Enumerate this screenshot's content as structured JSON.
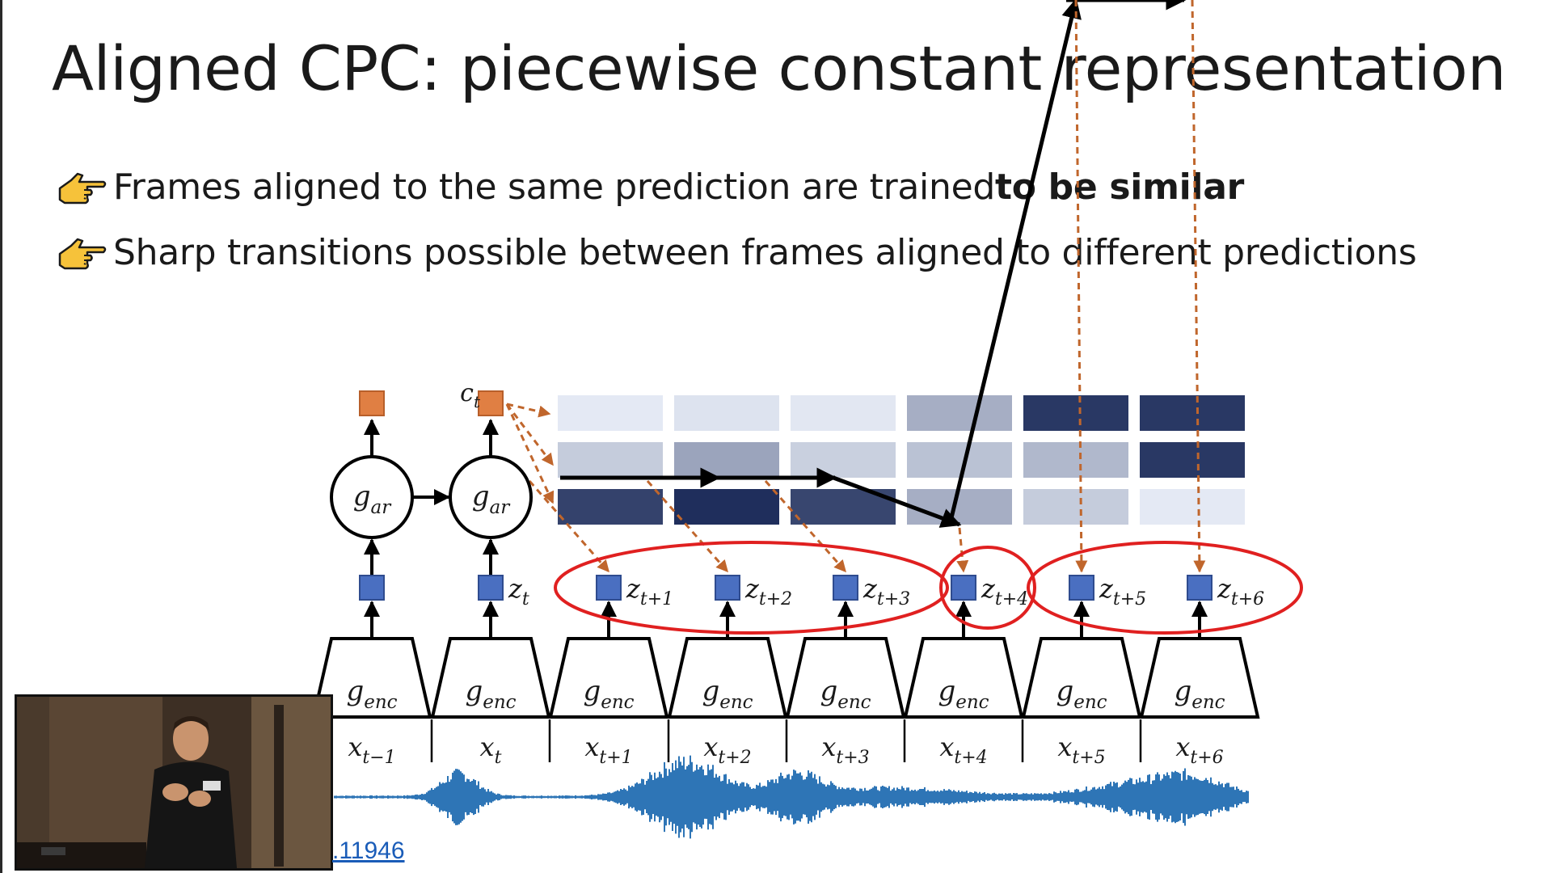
{
  "slide": {
    "title": "Aligned CPC: piecewise constant representation",
    "bullets": [
      {
        "text": "Frames aligned to the same prediction are trained ",
        "bold": "to be similar",
        "icon": "pointing-hand-icon"
      },
      {
        "text": "Sharp transitions possible between frames aligned to different predictions",
        "bold": "",
        "icon": "pointing-hand-icon"
      }
    ],
    "link_text": ".11946"
  },
  "diagram": {
    "context_label": "c",
    "context_sub": "t",
    "ar_nodes": [
      {
        "main": "g",
        "sub": "ar"
      },
      {
        "main": "g",
        "sub": "ar"
      }
    ],
    "z_labels": [
      {
        "main": "",
        "sub": ""
      },
      {
        "main": "z",
        "sub": "t"
      },
      {
        "main": "z",
        "sub": "t+1"
      },
      {
        "main": "z",
        "sub": "t+2"
      },
      {
        "main": "z",
        "sub": "t+3"
      },
      {
        "main": "z",
        "sub": "t+4"
      },
      {
        "main": "z",
        "sub": "t+5"
      },
      {
        "main": "z",
        "sub": "t+6"
      }
    ],
    "encoders": [
      {
        "main": "g",
        "sub": "enc"
      },
      {
        "main": "g",
        "sub": "enc"
      },
      {
        "main": "g",
        "sub": "enc"
      },
      {
        "main": "g",
        "sub": "enc"
      },
      {
        "main": "g",
        "sub": "enc"
      },
      {
        "main": "g",
        "sub": "enc"
      },
      {
        "main": "g",
        "sub": "enc"
      },
      {
        "main": "g",
        "sub": "enc"
      }
    ],
    "x_labels": [
      {
        "main": "x",
        "sub": "t−1"
      },
      {
        "main": "x",
        "sub": "t"
      },
      {
        "main": "x",
        "sub": "t+1"
      },
      {
        "main": "x",
        "sub": "t+2"
      },
      {
        "main": "x",
        "sub": "t+3"
      },
      {
        "main": "x",
        "sub": "t+4"
      },
      {
        "main": "x",
        "sub": "t+5"
      },
      {
        "main": "x",
        "sub": "t+6"
      }
    ],
    "alignment_matrix": [
      [
        0.05,
        0.08,
        0.06,
        0.35,
        0.95,
        0.95
      ],
      [
        0.2,
        0.4,
        0.18,
        0.25,
        0.3,
        0.95
      ],
      [
        0.9,
        1.0,
        0.88,
        0.35,
        0.2,
        0.05
      ]
    ],
    "alignment_path": [
      1,
      1,
      1,
      2,
      3,
      3
    ],
    "groups": [
      [
        2,
        3,
        4
      ],
      [
        5
      ],
      [
        6,
        7
      ]
    ],
    "colors": {
      "orange": "#e07f43",
      "blue": "#4a6fc1",
      "dark_blue": "#1f2e5c",
      "light_blue": "#eef3fc",
      "wave": "#2e75b6",
      "group_ring": "#e02020",
      "arrow": "#000000"
    }
  }
}
